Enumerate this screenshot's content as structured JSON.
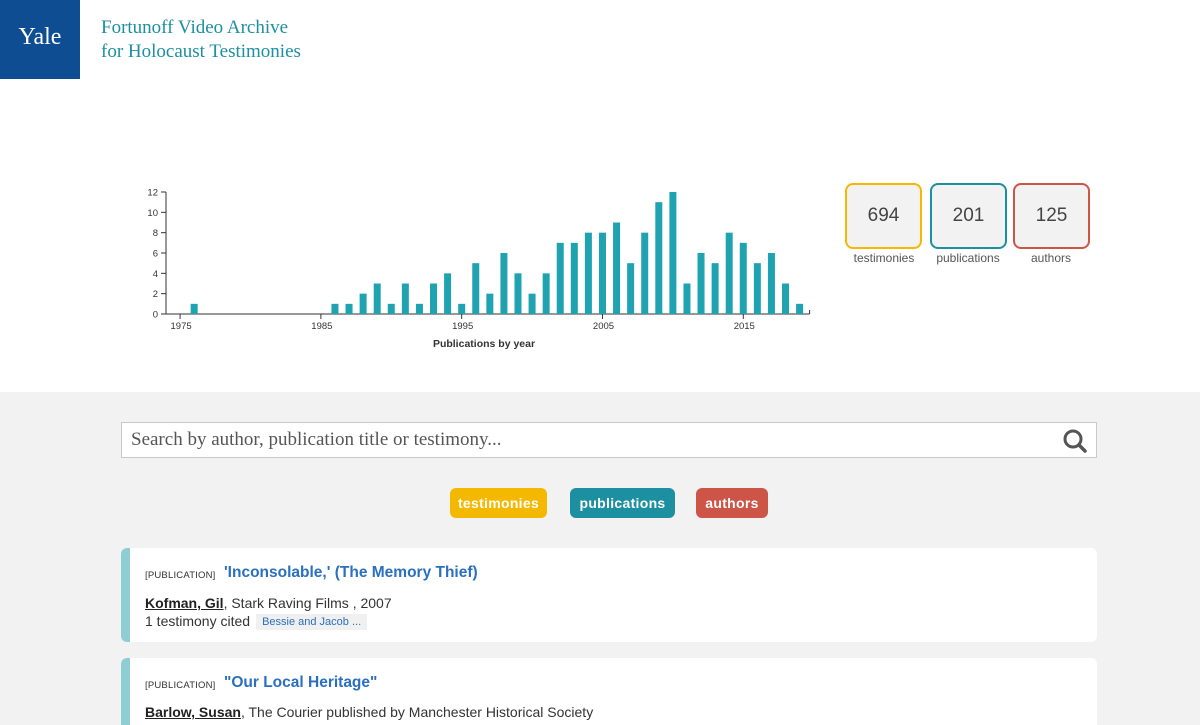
{
  "header": {
    "logo": "Yale",
    "title_line1": "Fortunoff Video Archive",
    "title_line2": "for Holocaust Testimonies"
  },
  "stats": [
    {
      "value": "694",
      "label": "testimonies",
      "color": "#f5b800"
    },
    {
      "value": "201",
      "label": "publications",
      "color": "#1c8fa0"
    },
    {
      "value": "125",
      "label": "authors",
      "color": "#cd5547"
    }
  ],
  "chart_data": {
    "type": "bar",
    "title": "",
    "xlabel": "Publications by year",
    "ylabel": "",
    "bar_color": "#1fa3b1",
    "xlim": [
      1974,
      2019
    ],
    "ylim": [
      0,
      12
    ],
    "yticks": [
      0,
      2,
      4,
      6,
      8,
      10,
      12
    ],
    "xticks": [
      1975,
      1985,
      1995,
      2005,
      2015
    ],
    "x": [
      1976,
      1986,
      1987,
      1988,
      1989,
      1990,
      1991,
      1992,
      1993,
      1994,
      1995,
      1996,
      1997,
      1998,
      1999,
      2000,
      2001,
      2002,
      2003,
      2004,
      2005,
      2006,
      2007,
      2008,
      2009,
      2010,
      2011,
      2012,
      2013,
      2014,
      2015,
      2016,
      2017,
      2018,
      2019
    ],
    "values": [
      1,
      1,
      1,
      2,
      3,
      1,
      3,
      1,
      3,
      4,
      1,
      5,
      2,
      6,
      4,
      2,
      4,
      7,
      7,
      8,
      8,
      9,
      5,
      8,
      11,
      12,
      3,
      6,
      5,
      8,
      7,
      5,
      6,
      3,
      1
    ]
  },
  "search": {
    "placeholder": "Search by author, publication title or testimony..."
  },
  "filters": [
    {
      "label": "testimonies",
      "color": "#f5b800"
    },
    {
      "label": "publications",
      "color": "#1c8fa0"
    },
    {
      "label": "authors",
      "color": "#cd5547"
    }
  ],
  "results": [
    {
      "type": "[PUBLICATION]",
      "title": "'Inconsolable,' (The Memory Thief)",
      "author": "Kofman, Gil",
      "details": ", Stark Raving Films , 2007",
      "cited": "1 testimony cited",
      "tag": "Bessie and Jacob ..."
    },
    {
      "type": "[PUBLICATION]",
      "title": "\"Our Local Heritage\"",
      "author": "Barlow, Susan",
      "details": ", The Courier published by Manchester Historical Society"
    }
  ]
}
